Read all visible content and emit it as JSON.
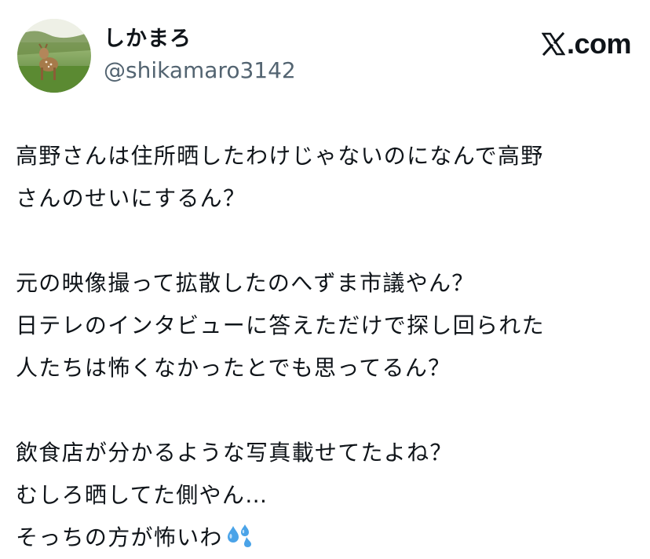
{
  "author": {
    "display_name": "しかまろ",
    "handle": "@shikamaro3142",
    "avatar_icon": "deer-photo-avatar"
  },
  "brand": {
    "text": ".com",
    "logo_icon": "x-logo-icon"
  },
  "tweet": {
    "paragraph1": {
      "line1": "高野さんは住所晒したわけじゃないのになんで高野",
      "line2": "さんのせいにするん？"
    },
    "paragraph2": {
      "line1": "元の映像撮って拡散したのへずま市議やん？",
      "line2": "日テレのインタビューに答えただけで探し回られた",
      "line3": "人たちは怖くなかったとでも思ってるん？"
    },
    "paragraph3": {
      "line1": "飲食店が分かるような写真載せてたよね？",
      "line2": "むしろ晒してた側やん…",
      "line3": "そっちの方が怖いわ"
    },
    "trailing_emoji": "sweat-droplets-emoji"
  },
  "colors": {
    "text_primary": "#0f1419",
    "text_secondary": "#536471",
    "emoji_blue": "#4aa3e8"
  }
}
